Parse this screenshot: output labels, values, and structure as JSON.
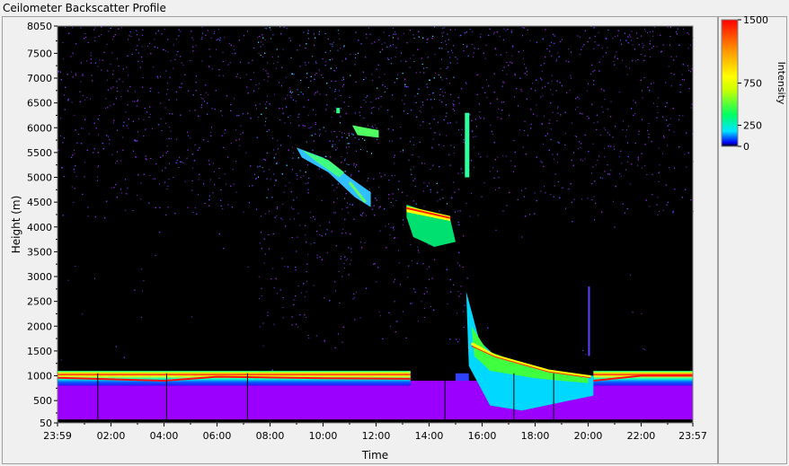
{
  "title": "Ceilometer Backscatter Profile",
  "chart_data": {
    "type": "heatmap",
    "title": "Ceilometer Backscatter Profile",
    "xlabel": "Time",
    "ylabel": "Height (m)",
    "x_ticks": [
      "23:59",
      "02:00",
      "04:00",
      "06:00",
      "08:00",
      "10:00",
      "12:00",
      "14:00",
      "16:00",
      "18:00",
      "20:00",
      "22:00",
      "23:57"
    ],
    "y_ticks": [
      50,
      500,
      1000,
      1500,
      2000,
      2500,
      3000,
      3500,
      4000,
      4500,
      5000,
      5500,
      6000,
      6500,
      7000,
      7500,
      8050
    ],
    "ylim": [
      50,
      8050
    ],
    "colorbar": {
      "label": "Intensity",
      "ticks": [
        0,
        250,
        750,
        1500
      ],
      "tick_labels": [
        "0",
        "250",
        "750",
        "1500"
      ],
      "range": [
        0,
        1500
      ]
    },
    "features": [
      {
        "name": "boundary layer",
        "x_range": [
          "23:59",
          "16:00"
        ],
        "height_m": 950,
        "intensity": 1500
      },
      {
        "name": "cloud layer",
        "x_range": [
          "13:10",
          "14:50"
        ],
        "height_m": 4250,
        "intensity": 1500
      },
      {
        "name": "cloud layer",
        "x_range": [
          "09:00",
          "12:30"
        ],
        "height_m": 5200,
        "intensity": 400
      },
      {
        "name": "descending layer",
        "x_range": [
          "15:30",
          "20:00"
        ],
        "height_m": 1200,
        "intensity": 1200
      }
    ],
    "colors": {
      "background": "#000000",
      "noise": "#8a2be2",
      "low": "#0000ff",
      "mid_low": "#00e5ff",
      "mid": "#00ff00",
      "mid_high": "#ffff00",
      "high": "#ff0000"
    }
  }
}
